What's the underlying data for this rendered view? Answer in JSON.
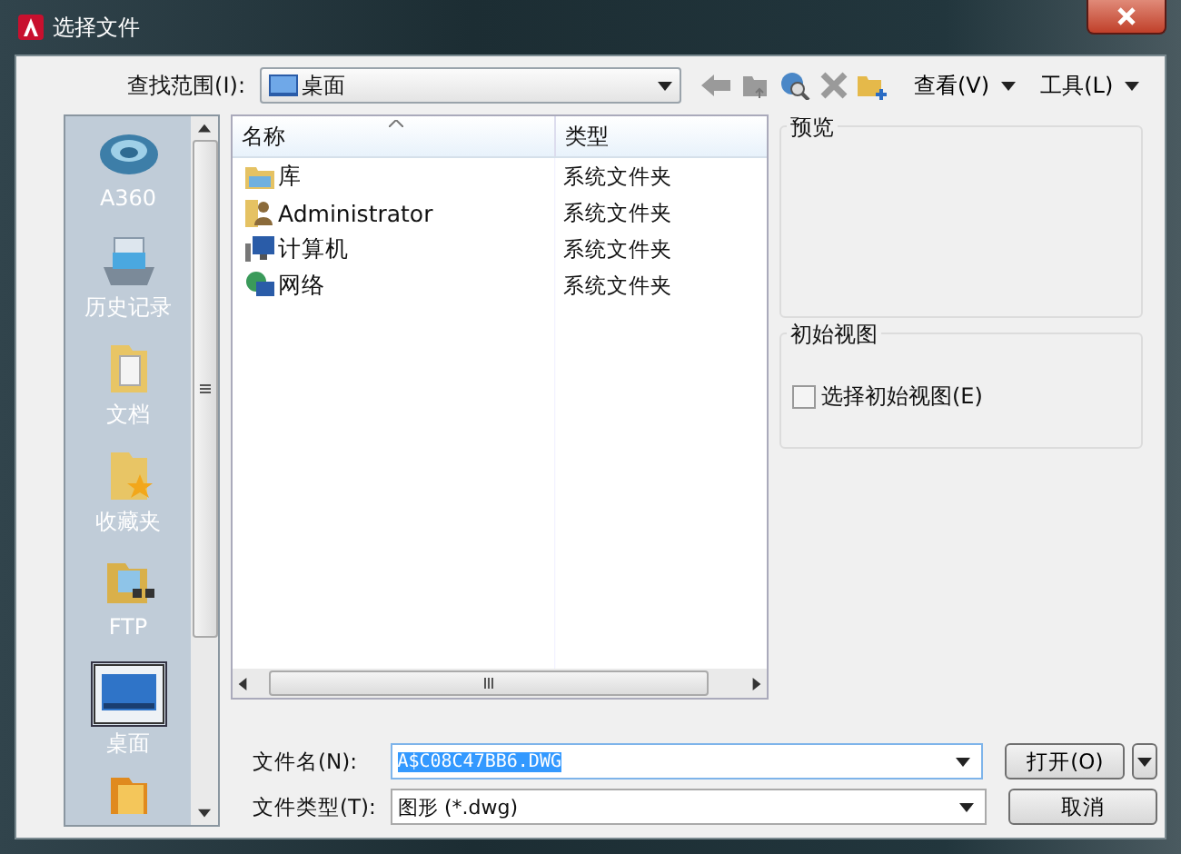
{
  "window": {
    "title": "选择文件"
  },
  "toolbar": {
    "look_in_label": "查找范围(I):",
    "look_in_value": "桌面",
    "view_menu": "查看(V)",
    "tools_menu": "工具(L)"
  },
  "sidebar": {
    "items": [
      {
        "kind": "cloud",
        "label": "A360",
        "selected": false
      },
      {
        "kind": "history",
        "label": "历史记录",
        "selected": false
      },
      {
        "kind": "documents",
        "label": "文档",
        "selected": false
      },
      {
        "kind": "favorites",
        "label": "收藏夹",
        "selected": false
      },
      {
        "kind": "ftp",
        "label": "FTP",
        "selected": false
      },
      {
        "kind": "desktop",
        "label": "桌面",
        "selected": true
      },
      {
        "kind": "folder",
        "selected": false
      }
    ]
  },
  "file_list": {
    "columns": [
      "名称",
      "类型"
    ],
    "rows": [
      {
        "kind": "library",
        "name": "库",
        "type": "系统文件夹"
      },
      {
        "kind": "user",
        "name": "Administrator",
        "type": "系统文件夹"
      },
      {
        "kind": "computer",
        "name": "计算机",
        "type": "系统文件夹"
      },
      {
        "kind": "network",
        "name": "网络",
        "type": "系统文件夹"
      }
    ]
  },
  "preview": {
    "title": "预览"
  },
  "initial_view": {
    "title": "初始视图",
    "checkbox": {
      "label": "选择初始视图(E)",
      "checked": false
    }
  },
  "file_name": {
    "label": "文件名(N):",
    "value": "A$C08C47BB6.DWG"
  },
  "file_type": {
    "label": "文件类型(T):",
    "value": "图形 (*.dwg)"
  },
  "buttons": {
    "open": "打开(O)",
    "cancel": "取消"
  }
}
